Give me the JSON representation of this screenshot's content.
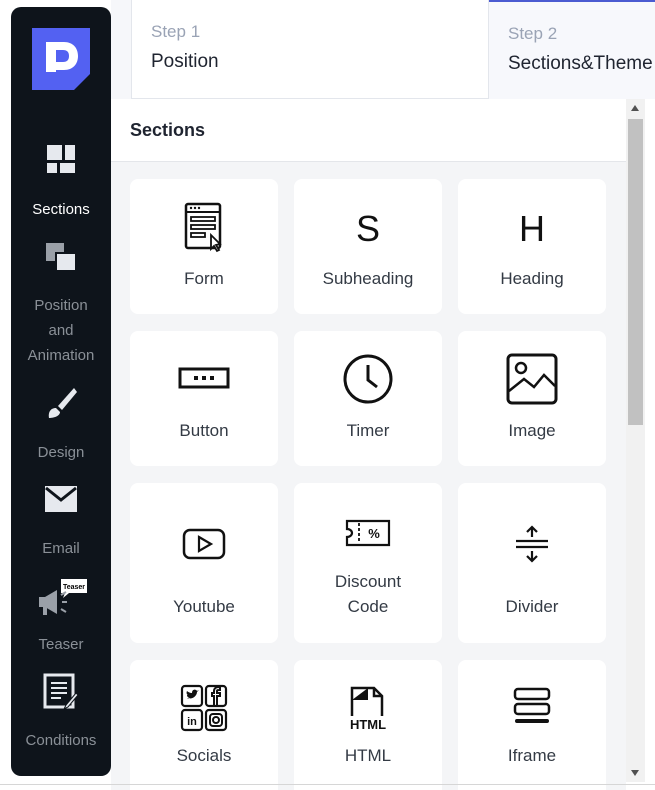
{
  "sidebar": {
    "items": [
      {
        "label": "Sections",
        "icon": "sections-icon",
        "active": true
      },
      {
        "label": "Position and Animation",
        "line1": "Position",
        "line2": "and",
        "line3": "Animation",
        "icon": "position-icon"
      },
      {
        "label": "Design",
        "icon": "brush-icon"
      },
      {
        "label": "Email",
        "icon": "envelope-icon"
      },
      {
        "label": "Teaser",
        "icon": "megaphone-icon",
        "badge": "Teaser"
      },
      {
        "label": "Conditions",
        "icon": "conditions-icon"
      }
    ]
  },
  "steps": [
    {
      "number": "Step 1",
      "name": "Position"
    },
    {
      "number": "Step 2",
      "name": "Sections&Theme"
    }
  ],
  "panel": {
    "title": "Sections",
    "cards": [
      {
        "label": "Form",
        "icon": "form-icon"
      },
      {
        "label": "Subheading",
        "icon": "subheading-icon",
        "glyph": "S"
      },
      {
        "label": "Heading",
        "icon": "heading-icon",
        "glyph": "H"
      },
      {
        "label": "Button",
        "icon": "button-icon"
      },
      {
        "label": "Timer",
        "icon": "clock-icon"
      },
      {
        "label": "Image",
        "icon": "image-icon"
      },
      {
        "label": "Youtube",
        "icon": "youtube-icon"
      },
      {
        "label": "Discount Code",
        "line1": "Discount",
        "line2": "Code",
        "icon": "discount-icon",
        "glyph": "%"
      },
      {
        "label": "Divider",
        "icon": "divider-icon"
      },
      {
        "label": "Socials",
        "icon": "socials-icon"
      },
      {
        "label": "HTML",
        "icon": "html-icon",
        "glyph": "HTML"
      },
      {
        "label": "Iframe",
        "icon": "iframe-icon"
      }
    ]
  },
  "colors": {
    "sidebar_bg": "#0e141b",
    "accent": "#4b5bd1",
    "logo": "#5361f2"
  }
}
